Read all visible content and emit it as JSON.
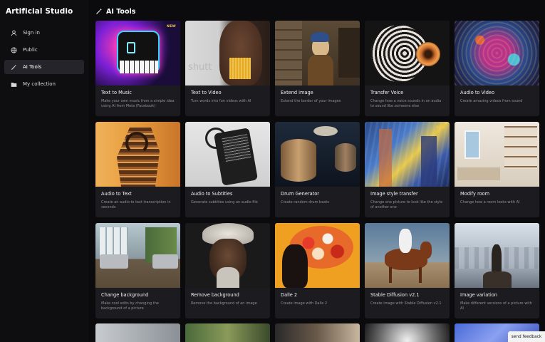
{
  "app": {
    "title": "Artificial Studio"
  },
  "sidebar": {
    "items": [
      {
        "label": "Sign in",
        "icon": "user-icon"
      },
      {
        "label": "Public",
        "icon": "globe-icon"
      },
      {
        "label": "AI Tools",
        "icon": "magic-wand-icon",
        "active": true
      },
      {
        "label": "My collection",
        "icon": "folder-icon"
      }
    ]
  },
  "page": {
    "title": "AI Tools"
  },
  "badge_new": "NEW",
  "cards": [
    {
      "title": "Text to Music",
      "desc": "Make your own music from a simple idea using AI from Meta (Facebook)",
      "new": true
    },
    {
      "title": "Text to Video",
      "desc": "Turn words into fun videos with AI"
    },
    {
      "title": "Extend image",
      "desc": "Extend the border of your images"
    },
    {
      "title": "Transfer Voice",
      "desc": "Change how a voice sounds in an audio to sound like someone else"
    },
    {
      "title": "Audio to Video",
      "desc": "Create amazing videos from sound"
    },
    {
      "title": "Audio to Text",
      "desc": "Create an audio to text transcription in seconds"
    },
    {
      "title": "Audio to Subtitles",
      "desc": "Generate subtitles using an audio file"
    },
    {
      "title": "Drum Generator",
      "desc": "Create random drum beats"
    },
    {
      "title": "Image style transfer",
      "desc": "Change one picture to look like the style of another one",
      "new": true
    },
    {
      "title": "Modify room",
      "desc": "Change how a room looks with AI"
    },
    {
      "title": "Change background",
      "desc": "Make cool edits by changing the background of a picture"
    },
    {
      "title": "Remove background",
      "desc": "Remove the background of an image"
    },
    {
      "title": "Dalle 2",
      "desc": "Create image with Dalle 2"
    },
    {
      "title": "Stable Diffusion v2.1",
      "desc": "Create image with Stable Diffusion v2.1"
    },
    {
      "title": "Image variation",
      "desc": "Make different versions of a picture with AI"
    }
  ],
  "feedback": {
    "label": "send feedback"
  }
}
